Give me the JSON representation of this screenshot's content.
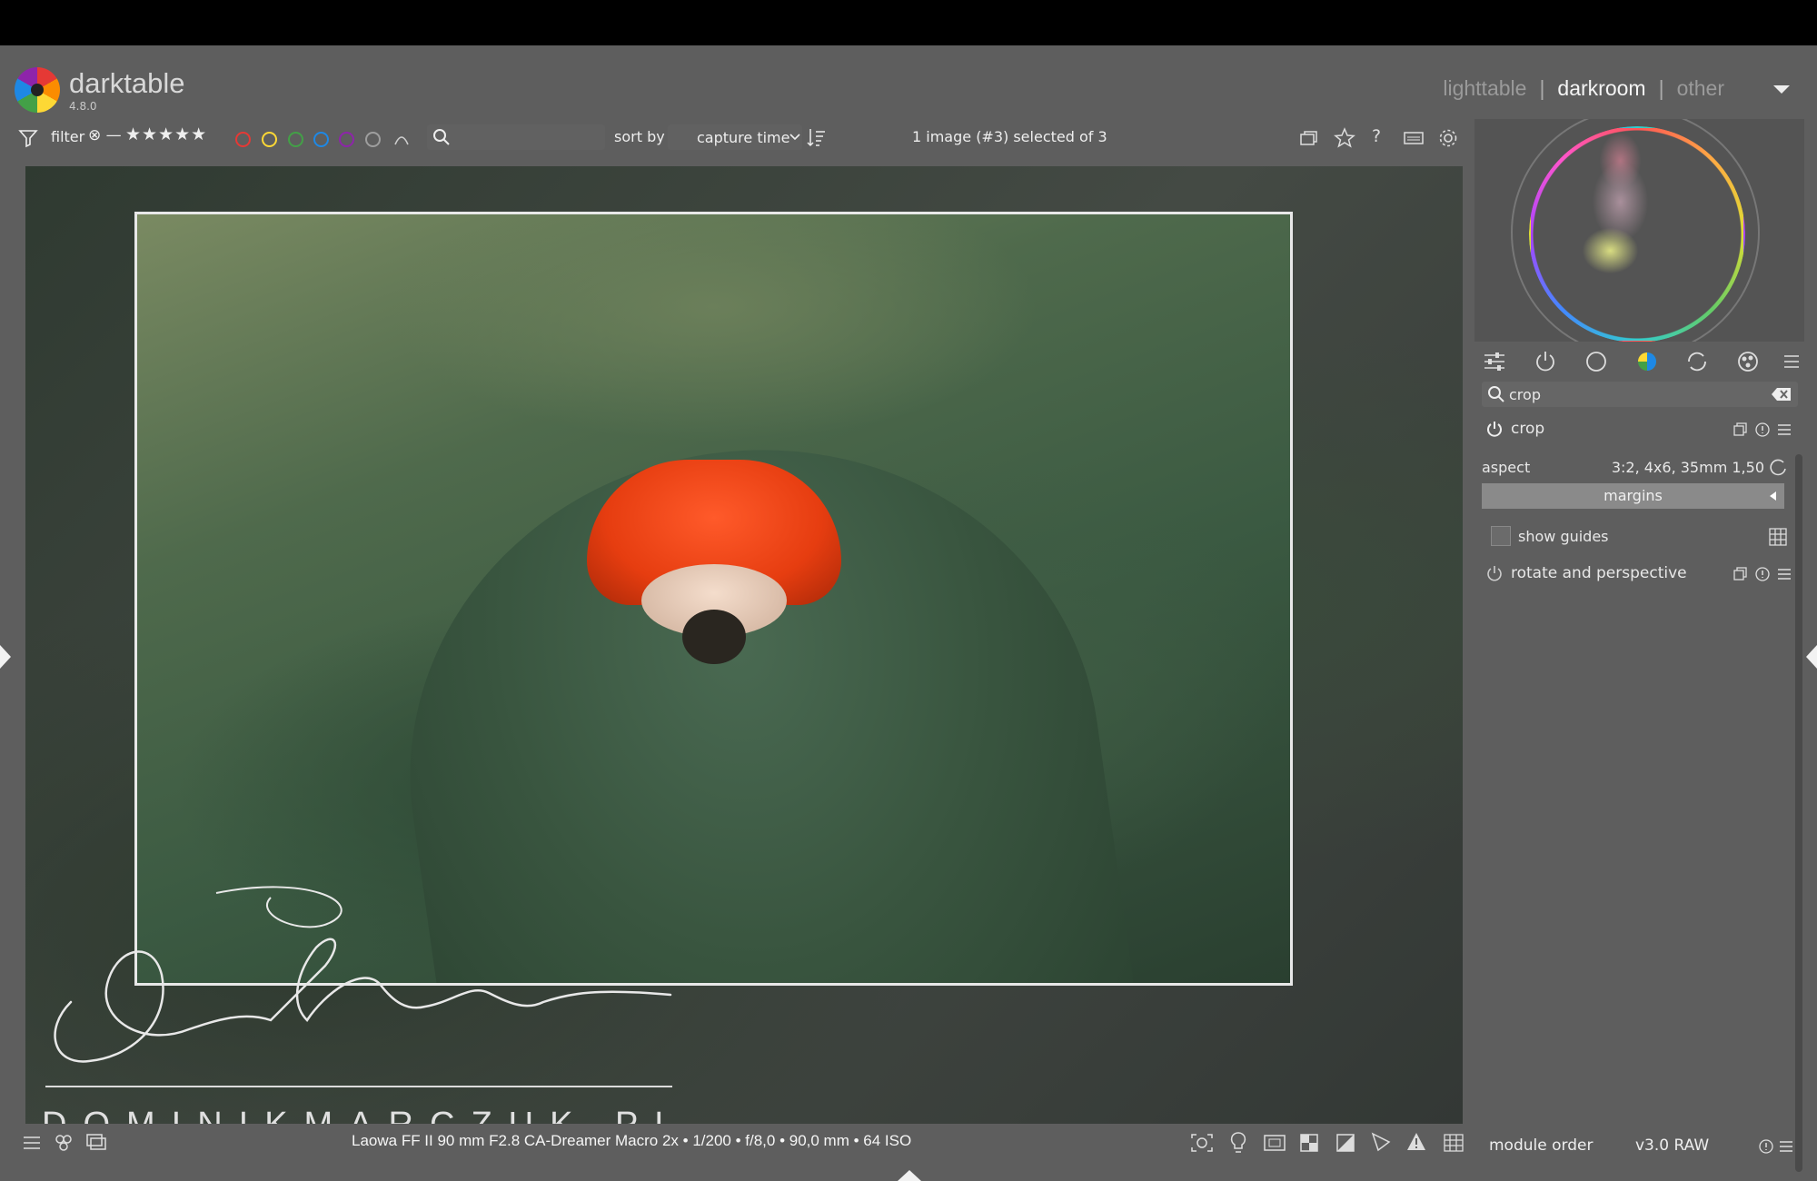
{
  "app": {
    "name": "darktable",
    "version": "4.8.0"
  },
  "views": {
    "items": [
      "lighttable",
      "darkroom",
      "other"
    ],
    "active": "darkroom"
  },
  "filterbar": {
    "filter_label": "filter",
    "rating_stars": "★★★★★",
    "rating_prefix": "⊗ —",
    "color_labels": [
      {
        "name": "red",
        "color": "#e53935"
      },
      {
        "name": "yellow",
        "color": "#fdd835"
      },
      {
        "name": "green",
        "color": "#43a047"
      },
      {
        "name": "blue",
        "color": "#1e88e5"
      },
      {
        "name": "purple",
        "color": "#8e24aa"
      },
      {
        "name": "gray",
        "color": "#9e9e9e"
      }
    ],
    "search_placeholder": "",
    "sort_label": "sort by",
    "sort_value": "capture time",
    "selection_status": "1 image (#3) selected of 3"
  },
  "image": {
    "watermark_signature": "Dominik Marczuk",
    "watermark_text": "DOMINIKMARCZUK.PL",
    "exif": "Laowa FF II 90 mm F2.8 CA-Dreamer Macro 2x • 1/200 • f/8,0 • 90,0 mm • 64 ISO"
  },
  "right_panel": {
    "module_search_value": "crop",
    "crop_module": {
      "title": "crop",
      "aspect_label": "aspect",
      "aspect_value": "3:2, 4x6, 35mm  1,50",
      "margins_label": "margins",
      "show_guides_label": "show guides"
    },
    "rotate_module": {
      "title": "rotate and perspective"
    },
    "module_order_label": "module order",
    "module_order_value": "v3.0 RAW"
  }
}
